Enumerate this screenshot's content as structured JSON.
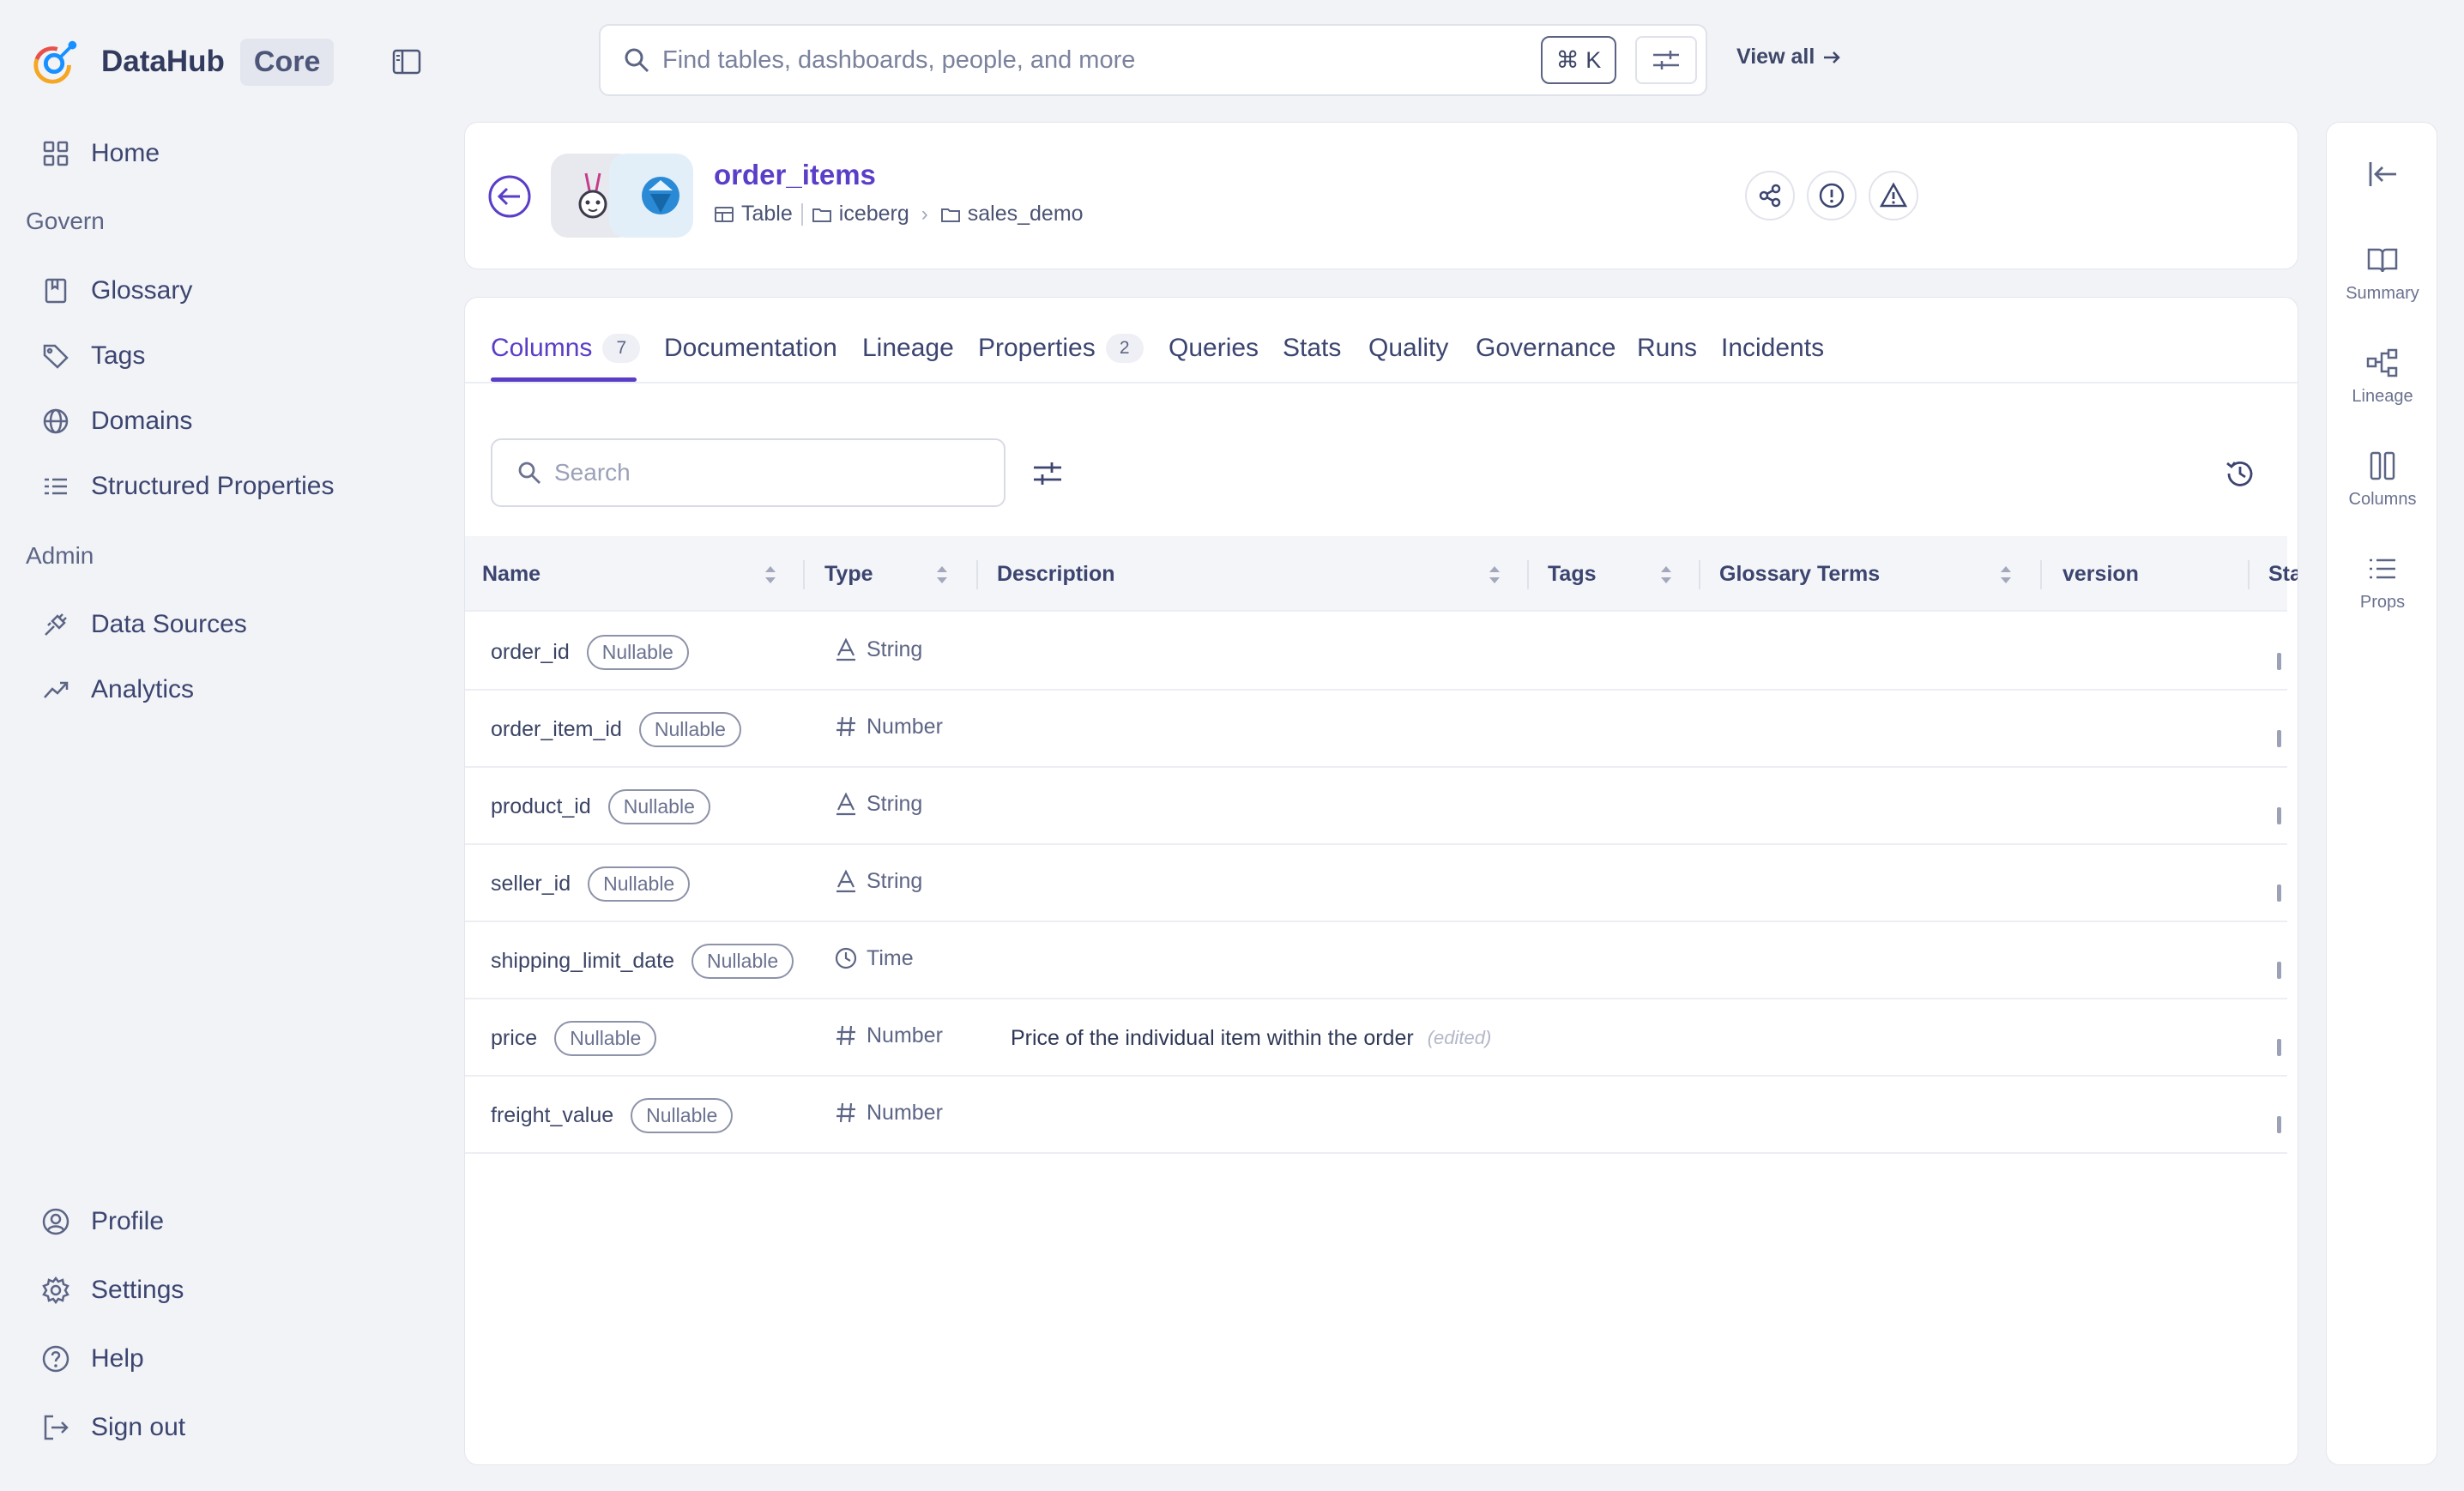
{
  "brand": {
    "name": "DataHub",
    "badge": "Core"
  },
  "sidebar": {
    "items": [
      {
        "label": "Home",
        "icon": "grid-icon"
      },
      {
        "label": "Glossary",
        "icon": "book-icon"
      },
      {
        "label": "Tags",
        "icon": "tag-icon"
      },
      {
        "label": "Domains",
        "icon": "globe-icon"
      },
      {
        "label": "Structured Properties",
        "icon": "list-icon"
      },
      {
        "label": "Data Sources",
        "icon": "plug-icon"
      },
      {
        "label": "Analytics",
        "icon": "trend-icon"
      }
    ],
    "sections": {
      "govern": "Govern",
      "admin": "Admin"
    },
    "bottom": [
      {
        "label": "Profile",
        "icon": "user-icon"
      },
      {
        "label": "Settings",
        "icon": "gear-icon"
      },
      {
        "label": "Help",
        "icon": "help-icon"
      },
      {
        "label": "Sign out",
        "icon": "sign-out-icon"
      }
    ]
  },
  "search": {
    "placeholder": "Find tables, dashboards, people, and more",
    "shortcut": "⌘ K",
    "view_all": "View all"
  },
  "entity": {
    "name": "order_items",
    "type": "Table",
    "breadcrumb": [
      "iceberg",
      "sales_demo"
    ]
  },
  "tabs": [
    {
      "label": "Columns",
      "count": "7"
    },
    {
      "label": "Documentation"
    },
    {
      "label": "Lineage"
    },
    {
      "label": "Properties",
      "count": "2"
    },
    {
      "label": "Queries"
    },
    {
      "label": "Stats"
    },
    {
      "label": "Quality"
    },
    {
      "label": "Governance"
    },
    {
      "label": "Runs"
    },
    {
      "label": "Incidents"
    }
  ],
  "columns_search": {
    "placeholder": "Search"
  },
  "table": {
    "headers": [
      "Name",
      "Type",
      "Description",
      "Tags",
      "Glossary Terms",
      "version",
      "Sta"
    ],
    "rows": [
      {
        "name": "order_id",
        "badge": "Nullable",
        "type": "String",
        "type_icon": "string-icon",
        "description": "",
        "edited": ""
      },
      {
        "name": "order_item_id",
        "badge": "Nullable",
        "type": "Number",
        "type_icon": "number-icon",
        "description": "",
        "edited": ""
      },
      {
        "name": "product_id",
        "badge": "Nullable",
        "type": "String",
        "type_icon": "string-icon",
        "description": "",
        "edited": ""
      },
      {
        "name": "seller_id",
        "badge": "Nullable",
        "type": "String",
        "type_icon": "string-icon",
        "description": "",
        "edited": ""
      },
      {
        "name": "shipping_limit_date",
        "badge": "Nullable",
        "type": "Time",
        "type_icon": "clock-icon",
        "description": "",
        "edited": ""
      },
      {
        "name": "price",
        "badge": "Nullable",
        "type": "Number",
        "type_icon": "number-icon",
        "description": "Price of the individual item within the order",
        "edited": "(edited)"
      },
      {
        "name": "freight_value",
        "badge": "Nullable",
        "type": "Number",
        "type_icon": "number-icon",
        "description": "",
        "edited": ""
      }
    ]
  },
  "rail": {
    "items": [
      {
        "label": "Summary",
        "icon": "book-open-icon"
      },
      {
        "label": "Lineage",
        "icon": "lineage-icon"
      },
      {
        "label": "Columns",
        "icon": "columns-icon"
      },
      {
        "label": "Props",
        "icon": "list-icon"
      }
    ]
  },
  "colors": {
    "accent": "#5a3ec8",
    "text": "#374066",
    "background": "#f1f3f7"
  }
}
